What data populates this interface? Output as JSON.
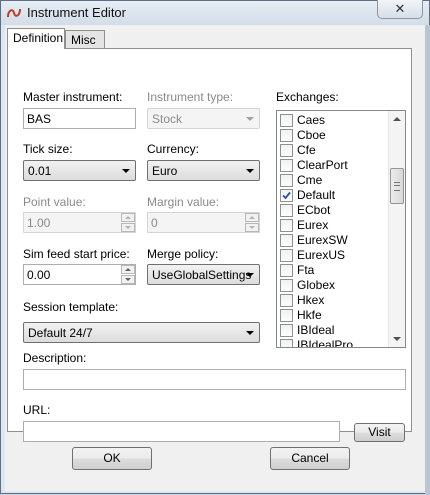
{
  "window": {
    "title": "Instrument Editor",
    "close_glyph": "✕"
  },
  "tabs": [
    {
      "label": "Definition",
      "active": true
    },
    {
      "label": "Misc",
      "active": false
    }
  ],
  "form": {
    "master_instrument": {
      "label": "Master instrument:",
      "value": "BAS"
    },
    "instrument_type": {
      "label": "Instrument type:",
      "value": "Stock",
      "enabled": false
    },
    "tick_size": {
      "label": "Tick size:",
      "value": "0.01"
    },
    "currency": {
      "label": "Currency:",
      "value": "Euro"
    },
    "point_value": {
      "label": "Point value:",
      "value": "1.00",
      "enabled": false
    },
    "margin_value": {
      "label": "Margin value:",
      "value": "0",
      "enabled": false
    },
    "sim_feed_start_price": {
      "label": "Sim feed start price:",
      "value": "0.00"
    },
    "merge_policy": {
      "label": "Merge policy:",
      "value": "UseGlobalSettings"
    },
    "session_template": {
      "label": "Session template:",
      "value": "Default 24/7"
    },
    "description": {
      "label": "Description:",
      "value": ""
    },
    "url": {
      "label": "URL:",
      "value": ""
    },
    "visit_button": "Visit"
  },
  "exchanges": {
    "label": "Exchanges:",
    "items": [
      {
        "name": "Caes",
        "checked": false
      },
      {
        "name": "Cboe",
        "checked": false
      },
      {
        "name": "Cfe",
        "checked": false
      },
      {
        "name": "ClearPort",
        "checked": false
      },
      {
        "name": "Cme",
        "checked": false
      },
      {
        "name": "Default",
        "checked": true
      },
      {
        "name": "ECbot",
        "checked": false
      },
      {
        "name": "Eurex",
        "checked": false
      },
      {
        "name": "EurexSW",
        "checked": false
      },
      {
        "name": "EurexUS",
        "checked": false
      },
      {
        "name": "Fta",
        "checked": false
      },
      {
        "name": "Globex",
        "checked": false
      },
      {
        "name": "Hkex",
        "checked": false
      },
      {
        "name": "Hkfe",
        "checked": false
      },
      {
        "name": "IBIdeal",
        "checked": false
      },
      {
        "name": "IBIdealPro",
        "checked": false
      }
    ]
  },
  "buttons": {
    "ok": "OK",
    "cancel": "Cancel"
  },
  "colors": {
    "check": "#2d4f9e",
    "app_icon": "#c0392b"
  }
}
